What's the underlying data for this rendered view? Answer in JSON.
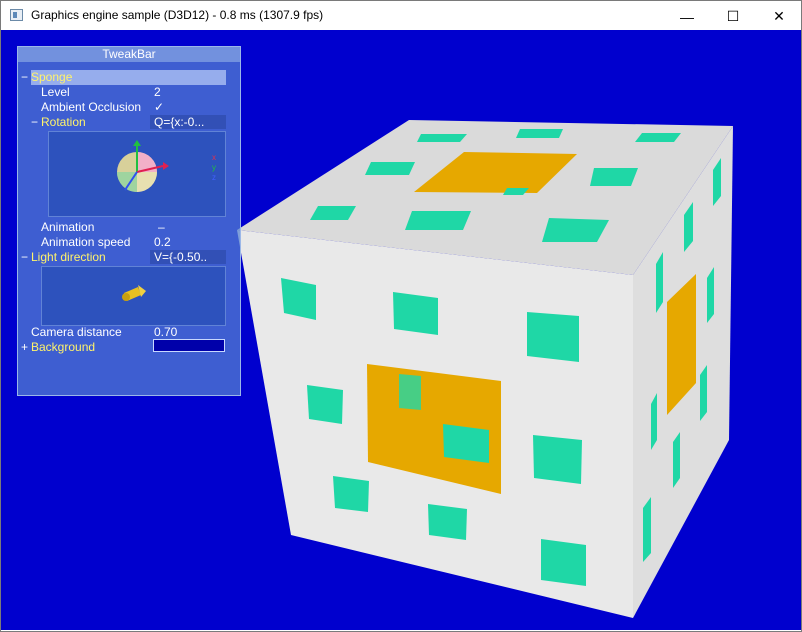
{
  "window": {
    "title": "Graphics engine sample (D3D12) - 0.8 ms (1307.9 fps)",
    "minimize_glyph": "—",
    "maximize_glyph": "☐",
    "close_glyph": "✕"
  },
  "viewport": {
    "background_color": "#0000ce"
  },
  "tweakbar": {
    "title": "TweakBar",
    "group_sponge": "Sponge",
    "group_sponge_toggle": "−",
    "level_label": "Level",
    "level_value": "2",
    "ao_label": "Ambient Occlusion",
    "ao_value": "✓",
    "rotation_toggle": "−",
    "rotation_label": "Rotation",
    "rotation_value": "Q={x:-0...",
    "animation_label": "Animation",
    "animation_value": "–",
    "animation_speed_label": "Animation speed",
    "animation_speed_value": "0.2",
    "light_toggle": "−",
    "light_label": "Light direction",
    "light_value": "V={-0.50..",
    "camera_label": "Camera distance",
    "camera_value": "0.70",
    "background_toggle": "+",
    "background_label": "Background",
    "background_color": "#0000aa",
    "axis_x": "x",
    "axis_y": "y",
    "axis_z": "z"
  },
  "sponge_colors": {
    "face": "#e6e6e6",
    "hole": "#1fd7a6",
    "inner": "#e6a800"
  }
}
